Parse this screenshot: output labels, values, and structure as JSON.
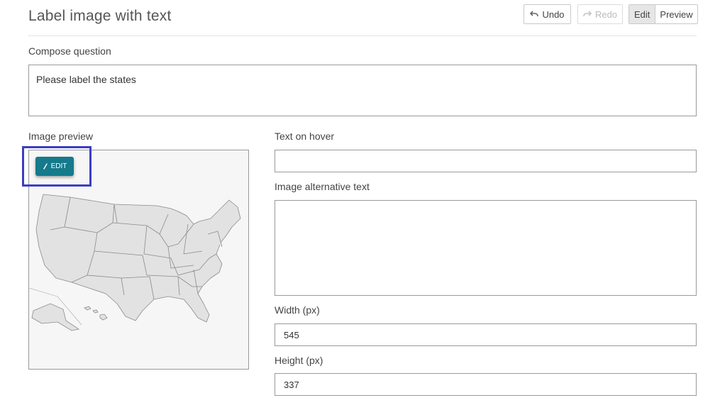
{
  "header": {
    "title": "Label image with text",
    "undo_label": "Undo",
    "redo_label": "Redo",
    "mode_tabs": [
      {
        "label": "Edit",
        "active": true
      },
      {
        "label": "Preview",
        "active": false
      }
    ]
  },
  "compose": {
    "label": "Compose question",
    "value": "Please label the states"
  },
  "image_preview": {
    "label": "Image preview",
    "edit_label": "EDIT",
    "image_icon": "us-map-image"
  },
  "fields": {
    "text_on_hover": {
      "label": "Text on hover",
      "value": ""
    },
    "alt_text": {
      "label": "Image alternative text",
      "value": ""
    },
    "width": {
      "label": "Width (px)",
      "value": "545"
    },
    "height": {
      "label": "Height (px)",
      "value": "337"
    }
  },
  "colors": {
    "edit_button": "#147a8c",
    "highlight": "#3b3fc4"
  }
}
